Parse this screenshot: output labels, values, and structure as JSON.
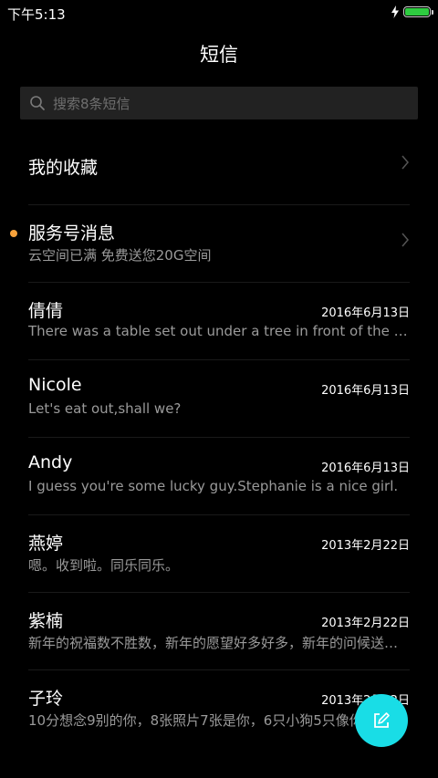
{
  "status": {
    "time": "下午5:13"
  },
  "header": {
    "title": "短信"
  },
  "search": {
    "placeholder": "搜索8条短信"
  },
  "pinned": [
    {
      "name": "我的收藏"
    },
    {
      "name": "服务号消息",
      "preview": "云空间已满 免费送您20G空间",
      "unread": true
    }
  ],
  "conversations": [
    {
      "name": "倩倩",
      "date": "2016年6月13日",
      "preview": "There was a table set out under a tree in front of the house"
    },
    {
      "name": "Nicole",
      "date": "2016年6月13日",
      "preview": "Let's eat out,shall we?"
    },
    {
      "name": "Andy",
      "date": "2016年6月13日",
      "preview": "I guess you're some lucky guy.Stephanie is a nice girl."
    },
    {
      "name": "燕婷",
      "date": "2013年2月22日",
      "preview": "嗯。收到啦。同乐同乐。"
    },
    {
      "name": "紫楠",
      "date": "2013年2月22日",
      "preview": "新年的祝福数不胜数，新年的愿望好多好多，新年的问候送给你"
    },
    {
      "name": "子玲",
      "date": "2013年2月22日",
      "preview": "10分想念9别的你，8张照片7张是你，6只小狗5只像你"
    }
  ],
  "colors": {
    "accent": "#19dde6",
    "unread_dot": "#f7a23b",
    "battery": "#2ecc40"
  }
}
